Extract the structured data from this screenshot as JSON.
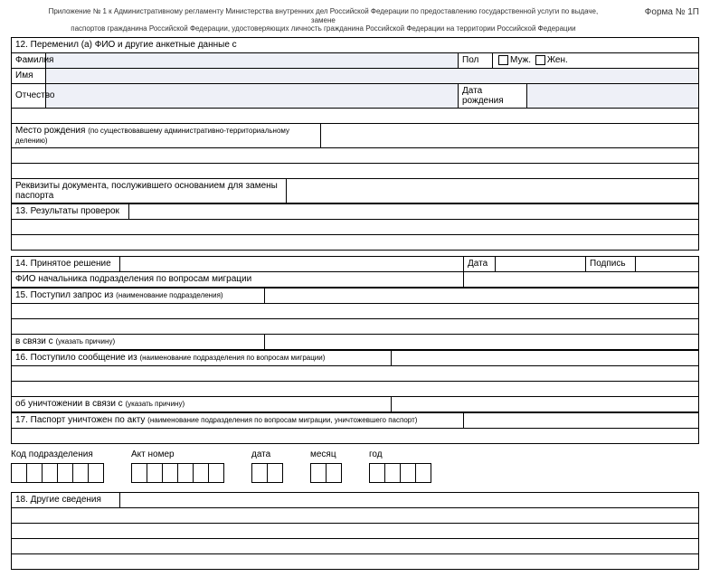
{
  "header": {
    "regulation_line1": "Приложение № 1 к Административному регламенту Министерства внутренних дел Российской Федерации по предоставлению государственной услуги по выдаче, замене",
    "regulation_line2": "паспортов гражданина Российской Федерации, удостоверяющих личность гражданина Российской Федерации на территории Российской Федерации",
    "form_no": "Форма № 1П"
  },
  "section12": {
    "title": "12. Переменил (а) ФИО и другие анкетные данные с",
    "surname": "Фамилия",
    "sex": "Пол",
    "male": "Муж.",
    "female": "Жен.",
    "name": "Имя",
    "patronymic": "Отчество",
    "dob": "Дата рождения",
    "birthplace": "Место рождения",
    "birthplace_note": "(по существовавшему административно-территориальному делению)",
    "doc_info": "Реквизиты документа, послужившего основанием для замены паспорта"
  },
  "section13": {
    "title": "13. Результаты проверок"
  },
  "section14": {
    "title": "14. Принятое решение",
    "date": "Дата",
    "sign": "Подпись",
    "fio_head": "ФИО начальника подразделения по вопросам миграции"
  },
  "section15": {
    "title": "15. Поступил запрос из",
    "note": "(наименование подразделения)",
    "connection": "в связи с",
    "connection_note": "(указать причину)"
  },
  "section16": {
    "title": "16. Поступило сообщение из",
    "note": "(наименование подразделения по вопросам миграции)",
    "destroy": "об уничтожении в связи с",
    "destroy_note": "(указать причину)"
  },
  "section17": {
    "title": "17. Паспорт уничтожен по акту",
    "note": "(наименование подразделения по вопросам миграции, уничтожевшего паспорт)"
  },
  "boxes": {
    "dept_code": "Код подразделения",
    "act_no": "Акт номер",
    "date": "дата",
    "month": "месяц",
    "year": "год"
  },
  "section18": {
    "title": "18. Другие сведения"
  }
}
